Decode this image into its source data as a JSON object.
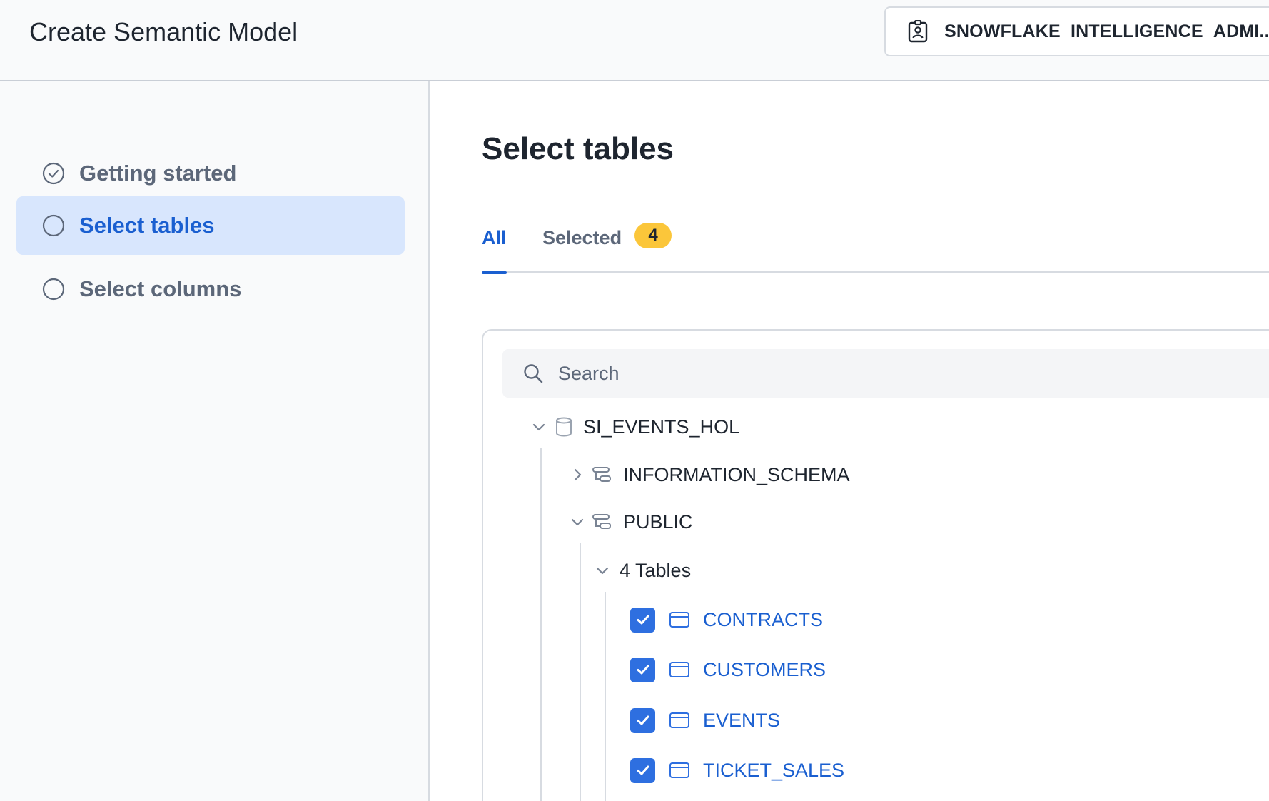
{
  "header": {
    "title": "Create Semantic Model",
    "role": "SNOWFLAKE_INTELLIGENCE_ADMI..."
  },
  "sidebar": {
    "steps": [
      {
        "label": "Getting started",
        "state": "completed"
      },
      {
        "label": "Select tables",
        "state": "active"
      },
      {
        "label": "Select columns",
        "state": "pending"
      }
    ]
  },
  "main": {
    "title": "Select tables",
    "tabs": {
      "all_label": "All",
      "selected_label": "Selected",
      "selected_count": "4"
    },
    "search": {
      "placeholder": "Search",
      "value": ""
    },
    "tree": {
      "database": "SI_EVENTS_HOL",
      "schema_info": "INFORMATION_SCHEMA",
      "schema_public": "PUBLIC",
      "tables_group": "4 Tables",
      "tables": [
        {
          "name": "CONTRACTS",
          "checked": true
        },
        {
          "name": "CUSTOMERS",
          "checked": true
        },
        {
          "name": "EVENTS",
          "checked": true
        },
        {
          "name": "TICKET_SALES",
          "checked": true
        }
      ]
    }
  },
  "colors": {
    "accent": "#1a5fd0",
    "checkbox": "#2e6fe0",
    "badge": "#fbc63a",
    "active_step_bg": "#d8e6fd"
  }
}
